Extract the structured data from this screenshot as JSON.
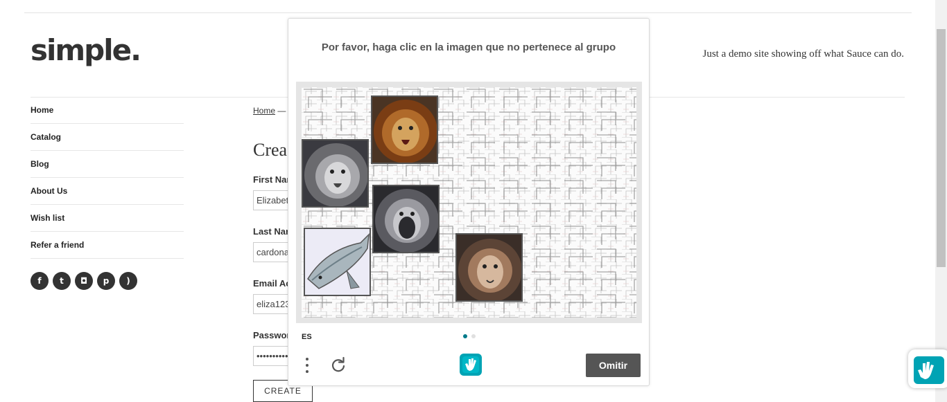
{
  "site": {
    "logo": "simple.",
    "tagline": "Just a demo site showing off what Sauce can do."
  },
  "sidebar": {
    "items": [
      {
        "label": "Home"
      },
      {
        "label": "Catalog"
      },
      {
        "label": "Blog"
      },
      {
        "label": "About Us"
      },
      {
        "label": "Wish list"
      },
      {
        "label": "Refer a friend"
      }
    ],
    "social": [
      {
        "icon": "facebook-icon",
        "glyph": "f"
      },
      {
        "icon": "twitter-icon",
        "glyph": "t"
      },
      {
        "icon": "instagram-icon",
        "glyph": "◘"
      },
      {
        "icon": "pinterest-icon",
        "glyph": "p"
      },
      {
        "icon": "rss-icon",
        "glyph": ")"
      }
    ]
  },
  "main": {
    "breadcrumb_home": "Home",
    "breadcrumb_sep": " —",
    "page_title": "Crea",
    "first_name_label": "First Nar",
    "first_name_value": "Elizabet",
    "last_name_label": "Last Nar",
    "last_name_value": "cardona",
    "email_label": "Email Ac",
    "email_value": "eliza123",
    "password_label": "Passwor",
    "password_value": "••••••••••",
    "create_button": "CREATE"
  },
  "captcha": {
    "prompt": "Por favor, haga clic en la imagen que no pertenece al grupo",
    "language": "ES",
    "skip_label": "Omitir",
    "pages": 2,
    "active_page": 1,
    "tiles": [
      "lion",
      "lion",
      "lion",
      "fish",
      "lion"
    ],
    "colors": {
      "brand": "#00a3b4",
      "skip_button": "#555555",
      "active_dot": "#007a8a"
    }
  }
}
